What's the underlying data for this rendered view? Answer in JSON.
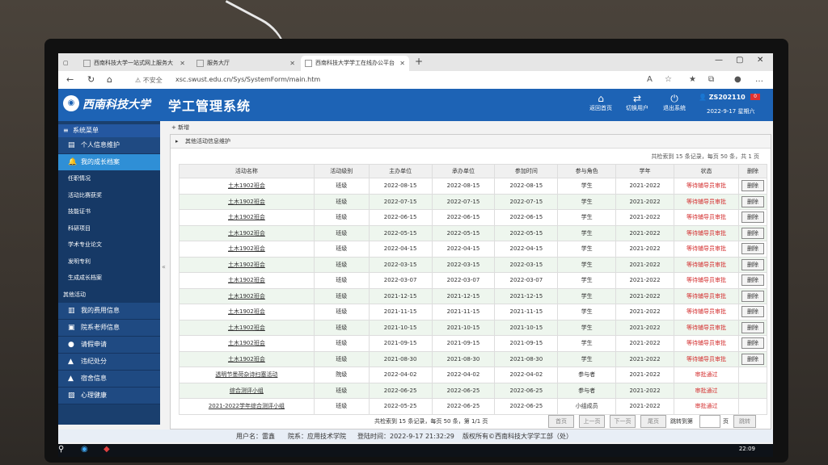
{
  "browser": {
    "tabs": [
      {
        "label": "西南科技大学一站式网上服务大"
      },
      {
        "label": "服务大厅"
      },
      {
        "label": "西南科技大学学工在线办公平台"
      }
    ],
    "security_label": "不安全",
    "url": "xsc.swust.edu.cn/Sys/SystemForm/main.htm"
  },
  "header": {
    "logo_text": "西南科技大学",
    "system_title": "学工管理系统",
    "buttons": [
      {
        "label": "返回首页",
        "icon": "home-icon"
      },
      {
        "label": "切换用户",
        "icon": "switch-user-icon"
      },
      {
        "label": "退出系统",
        "icon": "power-icon"
      }
    ],
    "user_id": "ZS202110",
    "mail_count": "0",
    "date": "2022-9-17 星期六"
  },
  "sidebar": {
    "menu_title": "系统菜单",
    "items_top": [
      {
        "label": "个人信息维护",
        "icon": "id-card-icon"
      },
      {
        "label": "我的成长档案",
        "icon": "bell-icon"
      }
    ],
    "sub_items": [
      "任职情况",
      "活动比赛获奖",
      "技能证书",
      "科研项目",
      "学术专业论文",
      "发明专利",
      "生成成长档案",
      "其他活动"
    ],
    "items_bottom": [
      {
        "label": "我的费用信息",
        "icon": "chart-icon"
      },
      {
        "label": "院系老师信息",
        "icon": "teacher-icon"
      },
      {
        "label": "请假申请",
        "icon": "pin-icon"
      },
      {
        "label": "违纪处分",
        "icon": "flask-icon"
      },
      {
        "label": "宿舍信息",
        "icon": "flask-icon"
      },
      {
        "label": "心理健康",
        "icon": "image-icon"
      }
    ]
  },
  "content": {
    "add_new": "新增",
    "panel_title": "其他活动信息维护",
    "page_info": "共检索到  15  条记录，每页  50  条，共  1  页",
    "columns": [
      "活动名称",
      "活动级别",
      "主办单位",
      "承办单位",
      "参加时间",
      "参与角色",
      "学年",
      "状态",
      "删除"
    ],
    "delete_label": "删除",
    "rows": [
      {
        "name": "土木1902班会",
        "level": "班级",
        "host": "2022-08-15",
        "organizer": "2022-08-15",
        "time": "2022-08-15",
        "role": "学生",
        "year": "2021-2022",
        "status": "等待辅导员审批"
      },
      {
        "name": "土木1902班会",
        "level": "班级",
        "host": "2022-07-15",
        "organizer": "2022-07-15",
        "time": "2022-07-15",
        "role": "学生",
        "year": "2021-2022",
        "status": "等待辅导员审批"
      },
      {
        "name": "土木1902班会",
        "level": "班级",
        "host": "2022-06-15",
        "organizer": "2022-06-15",
        "time": "2022-06-15",
        "role": "学生",
        "year": "2021-2022",
        "status": "等待辅导员审批"
      },
      {
        "name": "土木1902班会",
        "level": "班级",
        "host": "2022-05-15",
        "organizer": "2022-05-15",
        "time": "2022-05-15",
        "role": "学生",
        "year": "2021-2022",
        "status": "等待辅导员审批"
      },
      {
        "name": "土木1902班会",
        "level": "班级",
        "host": "2022-04-15",
        "organizer": "2022-04-15",
        "time": "2022-04-15",
        "role": "学生",
        "year": "2021-2022",
        "status": "等待辅导员审批"
      },
      {
        "name": "土木1902班会",
        "level": "班级",
        "host": "2022-03-15",
        "organizer": "2022-03-15",
        "time": "2022-03-15",
        "role": "学生",
        "year": "2021-2022",
        "status": "等待辅导员审批"
      },
      {
        "name": "土木1902班会",
        "level": "班级",
        "host": "2022-03-07",
        "organizer": "2022-03-07",
        "time": "2022-03-07",
        "role": "学生",
        "year": "2021-2022",
        "status": "等待辅导员审批"
      },
      {
        "name": "土木1902班会",
        "level": "班级",
        "host": "2021-12-15",
        "organizer": "2021-12-15",
        "time": "2021-12-15",
        "role": "学生",
        "year": "2021-2022",
        "status": "等待辅导员审批"
      },
      {
        "name": "土木1902班会",
        "level": "班级",
        "host": "2021-11-15",
        "organizer": "2021-11-15",
        "time": "2021-11-15",
        "role": "学生",
        "year": "2021-2022",
        "status": "等待辅导员审批"
      },
      {
        "name": "土木1902班会",
        "level": "班级",
        "host": "2021-10-15",
        "organizer": "2021-10-15",
        "time": "2021-10-15",
        "role": "学生",
        "year": "2021-2022",
        "status": "等待辅导员审批"
      },
      {
        "name": "土木1902班会",
        "level": "班级",
        "host": "2021-09-15",
        "organizer": "2021-09-15",
        "time": "2021-09-15",
        "role": "学生",
        "year": "2021-2022",
        "status": "等待辅导员审批"
      },
      {
        "name": "土木1902班会",
        "level": "班级",
        "host": "2021-08-30",
        "organizer": "2021-08-30",
        "time": "2021-08-30",
        "role": "学生",
        "year": "2021-2022",
        "status": "等待辅导员审批"
      },
      {
        "name": "透明节墨荷杂诗扫塞活动",
        "level": "院级",
        "host": "2022-04-02",
        "organizer": "2022-04-02",
        "time": "2022-04-02",
        "role": "参与者",
        "year": "2021-2022",
        "status": "审批通过"
      },
      {
        "name": "综合测评小组",
        "level": "班级",
        "host": "2022-06-25",
        "organizer": "2022-06-25",
        "time": "2022-06-25",
        "role": "参与者",
        "year": "2021-2022",
        "status": "审批通过"
      },
      {
        "name": "2021-2022学年综合测评小组",
        "level": "班级",
        "host": "2022-05-25",
        "organizer": "2022-06-25",
        "time": "2022-06-25",
        "role": "小组成员",
        "year": "2021-2022",
        "status": "审批通过"
      }
    ],
    "pager": {
      "summary": "共检索到  15  条记录，每页  50  条，第  1/1  页",
      "first": "首页",
      "prev": "上一页",
      "next": "下一页",
      "last": "尾页",
      "jump_label": "跳转到第",
      "page_unit": "页",
      "go": "跳转"
    }
  },
  "footer": {
    "user": "用户名：雷鑫",
    "dept": "院系：应用技术学院",
    "login_time": "登陆时间：2022-9-17 21:32:29",
    "copyright": "版权所有©西南科技大学学工部（处）"
  },
  "taskbar": {
    "clock": "22:09"
  },
  "colors": {
    "header_blue": "#1d63b5",
    "sidebar_dark": "#1a3f6e",
    "highlight": "#2f8fd6",
    "status_red": "#d43030"
  }
}
